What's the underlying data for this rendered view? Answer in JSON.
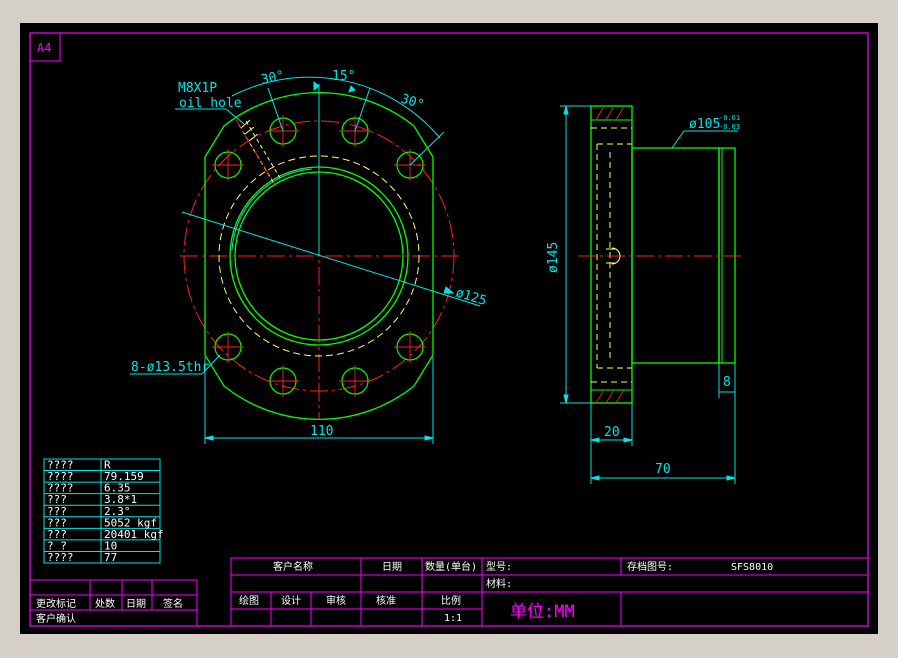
{
  "sheet": {
    "size_label": "A4"
  },
  "front_view": {
    "thread_note": "M8X1P",
    "hole_note": "oil hole",
    "angle_left": "30°",
    "angle_mid": "15°",
    "angle_right": "30°",
    "pcd_label": "ø125",
    "holes_label": "8-ø13.5thr",
    "width_label": "110"
  },
  "side_view": {
    "od_label": "ø105",
    "od_tol_upper": "-0.01",
    "od_tol_lower": "-0.03",
    "flange_dia_label": "ø145",
    "flange_thk_label": "20",
    "length_label": "70",
    "groove_label": "8"
  },
  "spec_table": {
    "rows": [
      {
        "name": "????",
        "value": "R"
      },
      {
        "name": "????",
        "value": "79.159"
      },
      {
        "name": "????",
        "value": "6.35"
      },
      {
        "name": "???",
        "value": "3.8*1"
      },
      {
        "name": "???",
        "value": "2.3°"
      },
      {
        "name": "???",
        "value": "5052 kgf"
      },
      {
        "name": "???",
        "value": "20401 kgf"
      },
      {
        "name": "?  ?",
        "value": "10"
      },
      {
        "name": "????",
        "value": "77"
      }
    ]
  },
  "revision_block": {
    "change_mark": "更改标记",
    "location": "处数",
    "date": "日期",
    "signature": "签名",
    "customer_confirm": "客户确认"
  },
  "title_block": {
    "customer_name": "客户名称",
    "date": "日期",
    "quantity": "数量(单台)",
    "model": "型号:",
    "material": "材料:",
    "drawing_no_label": "存档图号:",
    "drawing_no": "SFS8010",
    "drawn": "绘图",
    "design": "设计",
    "check": "审核",
    "approve": "核准",
    "scale": "比例",
    "scale_value": "1:1",
    "unit": "单位:MM"
  },
  "colors": {
    "background": "#000000",
    "frame": "#ff00ff",
    "outline": "#00ff00",
    "dimension": "#00e5e5",
    "center": "#ff2020",
    "hidden": "#ffff66",
    "text": "#ffffff"
  }
}
